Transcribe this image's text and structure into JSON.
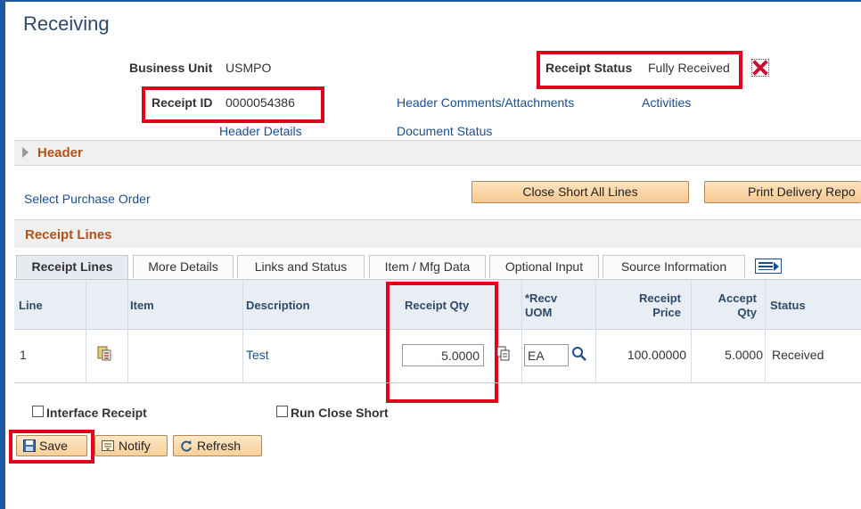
{
  "page": {
    "title": "Receiving"
  },
  "summary": {
    "business_unit_label": "Business Unit",
    "business_unit_value": "USMPO",
    "receipt_id_label": "Receipt ID",
    "receipt_id_value": "0000054386",
    "receipt_status_label": "Receipt Status",
    "receipt_status_value": "Fully Received",
    "links": {
      "header_comments": "Header Comments/Attachments",
      "activities": "Activities",
      "header_details": "Header Details",
      "document_status": "Document Status"
    }
  },
  "header_section": {
    "title": "Header"
  },
  "actions": {
    "select_po": "Select Purchase Order",
    "close_short_all": "Close Short All Lines",
    "print_delivery": "Print Delivery Repo"
  },
  "receipt_lines": {
    "section_title": "Receipt Lines",
    "tabs": [
      "Receipt Lines",
      "More Details",
      "Links and Status",
      "Item / Mfg Data",
      "Optional Input",
      "Source Information"
    ],
    "columns": {
      "line": "Line",
      "item": "Item",
      "description": "Description",
      "receipt_qty": "Receipt Qty",
      "recv_uom_1": "*Recv",
      "recv_uom_2": "UOM",
      "receipt_price_1": "Receipt",
      "receipt_price_2": "Price",
      "accept_qty_1": "Accept",
      "accept_qty_2": "Qty",
      "status": "Status"
    },
    "rows": [
      {
        "line": "1",
        "item": "",
        "description": "Test",
        "receipt_qty": "5.0000",
        "recv_uom": "EA",
        "receipt_price": "100.00000",
        "accept_qty": "5.0000",
        "status": "Received"
      }
    ]
  },
  "options": {
    "interface_receipt": "Interface Receipt",
    "run_close_short": "Run Close Short"
  },
  "toolbar": {
    "save": "Save",
    "notify": "Notify",
    "refresh": "Refresh"
  },
  "colors": {
    "highlight_red": "#e3001b",
    "section_title": "#b0531a",
    "link_blue": "#1a4f8c",
    "frame_blue": "#1c5aa6"
  }
}
